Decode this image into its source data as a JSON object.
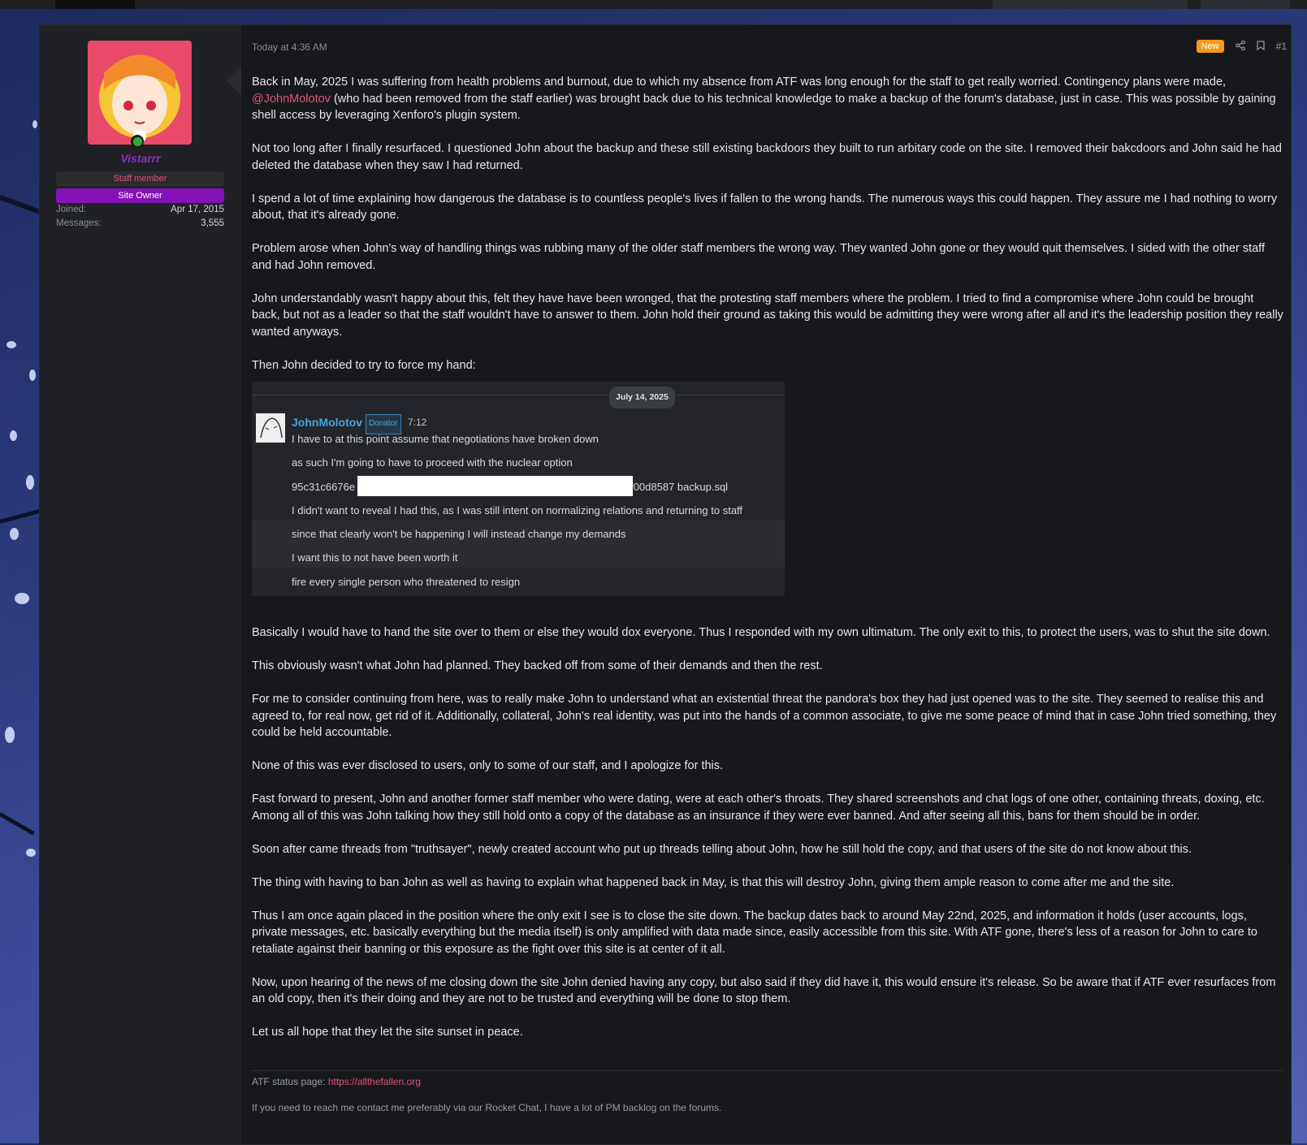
{
  "post": {
    "timestamp": "Today at 4:36 AM",
    "new_badge": "New",
    "post_number": "#1",
    "author": {
      "name": "Vistarrr",
      "banner_staff": "Staff member",
      "banner_owner": "Site Owner",
      "joined_label": "Joined:",
      "joined_value": "Apr 17, 2015",
      "messages_label": "Messages:",
      "messages_value": "3,555"
    },
    "paragraphs": {
      "p1_before": "Back in May, 2025 I was suffering from health problems and burnout, due to which my absence from ATF was long enough for the staff to get really worried. Contingency plans were made,",
      "p1_mention": "@JohnMolotov",
      "p1_after": " (who had been removed from the staff earlier) was brought back due to his technical knowledge to make a backup of the forum's database, just in case. This was possible by gaining shell access by leveraging Xenforo's plugin system.",
      "p2": "Not too long after I finally resurfaced. I questioned John about the backup and these still existing backdoors they built to run arbitary code on the site. I removed their bakcdoors and John said he had deleted the database when they saw I had returned.",
      "p3": "I spend a lot of time explaining how dangerous the database is to countless people's lives if fallen to the wrong hands. The numerous ways this could happen. They assure me I had nothing to worry about, that it's already gone.",
      "p4": "Problem arose when John's way of handling things was rubbing many of the older staff members the wrong way. They wanted John gone or they would quit themselves. I sided with the other staff and had John removed.",
      "p5": "John understandably wasn't happy about this, felt they have have been wronged, that the protesting staff members where the problem. I tried to find a compromise where John could be brought back, but not as a leader so that the staff wouldn't have to answer to them. John hold their ground as taking this would be admitting they were wrong after all and it's the leadership position they really wanted anyways.",
      "p6": "Then John decided to try to force my hand:",
      "p7": "Basically I would have to hand the site over to them or else they would dox everyone. Thus I responded with my own ultimatum. The only exit to this, to protect the users, was to shut the site down.",
      "p8": "This obviously wasn't what John had planned. They backed off from some of their demands and then the rest.",
      "p9": "For me to consider continuing from here, was to really make John to understand what an existential threat the pandora's box they had just opened was to the site. They seemed to realise this and agreed to, for real now, get rid of it. Additionally, collateral, John's real identity, was put into the hands of a common associate, to give me some peace of mind that in case John tried something, they could be held accountable.",
      "p10": "None of this was ever disclosed to users, only to some of our staff, and I apologize for this.",
      "p11": "Fast forward to present, John and another former staff member who were dating, were at each other's throats. They shared screenshots and chat logs of one other, containing threats, doxing, etc. Among all of this was John talking how they still hold onto a copy of the database as an insurance if they were ever banned. And after seeing all this, bans for them should be in order.",
      "p12": "Soon after came threads from \"truthsayer\", newly created account who put up threads telling about John, how he still hold the copy, and that users of the site do not know about this.",
      "p13": "The thing with having to ban John as well as having to explain what happened back in May, is that this will destroy John, giving them ample reason to come after me and the site.",
      "p14": "Thus I am once again placed in the position where the only exit I see is to close the site down. The backup dates back to around May 22nd, 2025, and information it holds (user accounts, logs, private messages, etc. basically everything but the media itself) is only amplified with data made since, easily accessible from this site. With ATF gone, there's less of a reason for John to care to retaliate against their banning or this exposure as the fight over this site is at center of it all.",
      "p15": "Now, upon hearing of the news of me closing down the site John denied having any copy, but also said if they did have it, this would ensure it's release. So be aware that if ATF ever resurfaces from an old copy, then it's their doing and they are not to be trusted and everything will be done to stop them.",
      "p16": "Let us all hope that they let the site sunset in peace."
    },
    "chat": {
      "date": "July 14, 2025",
      "user": "JohnMolotov",
      "tag": "Donator",
      "time": "7:12",
      "m1": "I have to at this point assume that negotiations have broken down",
      "m2": "as such I'm going to have to proceed with the nuclear option",
      "m3_left": "95c31c6676e",
      "m3_right": "f00d8587 backup.sql",
      "m4": "I didn't want to reveal I had this, as I was still intent on normalizing relations and returning to staff",
      "m5": "since that clearly won't be happening I will instead change my demands",
      "m6": "I want this to not have been worth it",
      "m7": "fire every single person who threatened to resign"
    },
    "signature": {
      "status_label": "ATF status page: ",
      "status_link": "https://allthefallen.org",
      "contact": "If you need to reach me contact me preferably via our Rocket Chat, I have a lot of PM backlog on the forums."
    }
  },
  "icons": {
    "share": "share-icon",
    "bookmark": "bookmark-icon",
    "online": "online-status-icon"
  }
}
